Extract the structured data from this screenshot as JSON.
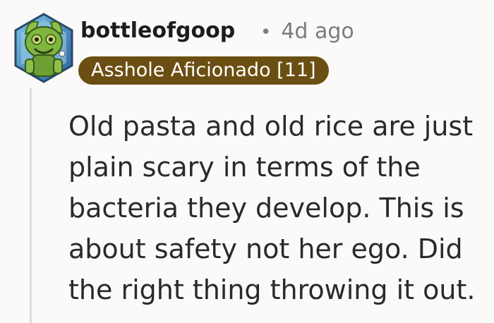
{
  "comment": {
    "username": "bottleofgoop",
    "separator": "•",
    "timestamp": "4d ago",
    "flair": "Asshole Aficionado [11]",
    "body": "Old pasta and old rice are just plain scary in terms of the bacteria they develop. This is about safety not her ego. Did the right thing throwing it out.",
    "avatar_icon": "goblin-creature-avatar"
  },
  "colors": {
    "flair_background": "#6b4f12",
    "flair_text": "#ffffff",
    "username": "#1c1c1c",
    "meta": "#7c7c7c",
    "body_text": "#2a2a2a",
    "thread_line": "#dcdcdc"
  }
}
